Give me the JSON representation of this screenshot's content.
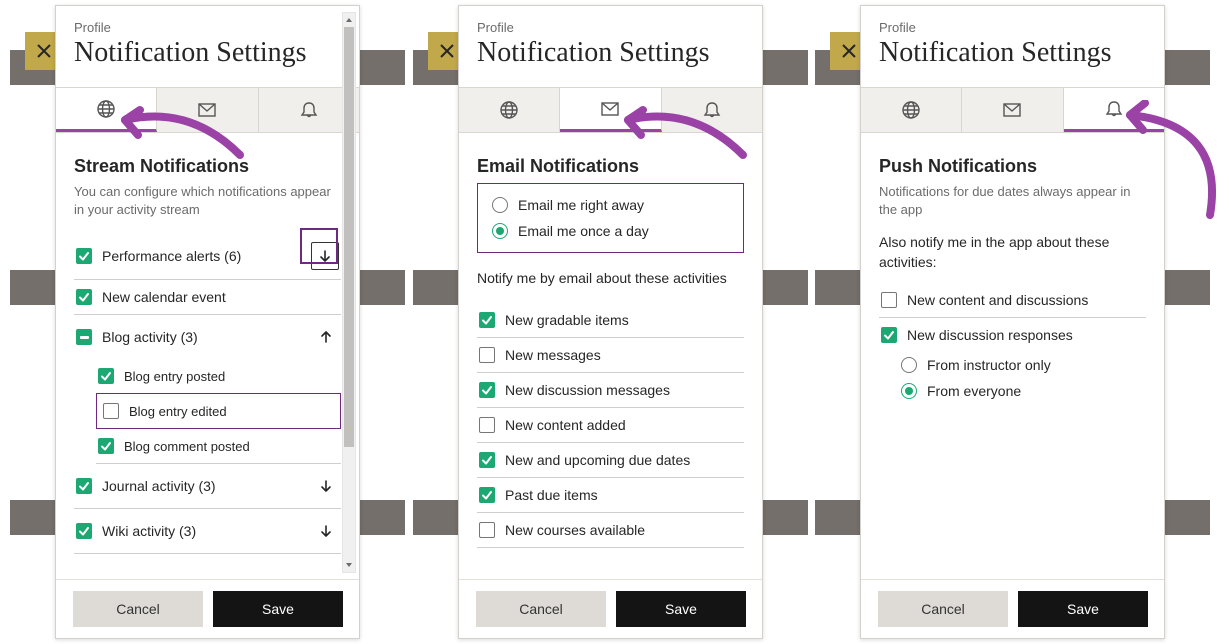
{
  "common": {
    "breadcrumb": "Profile",
    "title": "Notification Settings",
    "cancel": "Cancel",
    "save": "Save"
  },
  "stream": {
    "title": "Stream Notifications",
    "desc": "You can configure which notifications appear in your activity stream",
    "items": {
      "performance": "Performance alerts (6)",
      "calendar": "New calendar event",
      "blog": "Blog activity (3)",
      "blog_posted": "Blog entry posted",
      "blog_edited": "Blog entry edited",
      "blog_comment": "Blog comment posted",
      "journal": "Journal activity (3)",
      "wiki": "Wiki activity (3)"
    }
  },
  "email": {
    "title": "Email Notifications",
    "freq": {
      "right_away": "Email me right away",
      "once": "Email me once a day"
    },
    "desc": "Notify me by email about these activities",
    "items": {
      "gradable": "New gradable items",
      "messages": "New messages",
      "disc": "New discussion messages",
      "content": "New content added",
      "due": "New and upcoming due dates",
      "past": "Past due items",
      "courses": "New courses available"
    }
  },
  "push": {
    "title": "Push Notifications",
    "desc": "Notifications for due dates always appear in the app",
    "sub": "Also notify me in the app about these activities:",
    "items": {
      "content": "New content and discussions",
      "responses": "New discussion responses",
      "from_instructor": "From instructor only",
      "from_everyone": "From everyone"
    }
  }
}
